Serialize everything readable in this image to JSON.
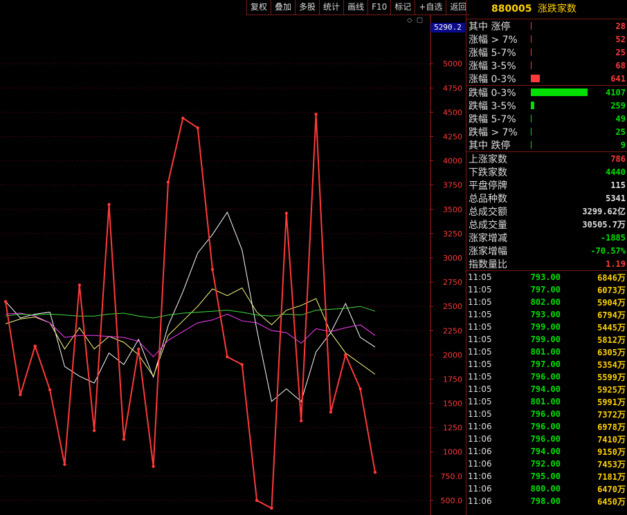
{
  "toolbar": [
    "复权",
    "叠加",
    "多股",
    "统计",
    "画线",
    "F10",
    "标记",
    "+自选",
    "返回"
  ],
  "current_price": "5290.2",
  "panel": {
    "code": "880005",
    "name": "涨跌家数",
    "rise": [
      {
        "label": "其中 涨停",
        "count": "28",
        "level": 0.007
      },
      {
        "label": "涨幅 > 7%",
        "count": "52",
        "level": 0.013
      },
      {
        "label": "涨幅 5-7%",
        "count": "25",
        "level": 0.006
      },
      {
        "label": "涨幅 3-5%",
        "count": "68",
        "level": 0.017
      },
      {
        "label": "涨幅 0-3%",
        "count": "641",
        "level": 0.156
      }
    ],
    "fall": [
      {
        "label": "跌幅 0-3%",
        "count": "4107",
        "level": 1.0
      },
      {
        "label": "跌幅 3-5%",
        "count": "259",
        "level": 0.063
      },
      {
        "label": "跌幅 5-7%",
        "count": "49",
        "level": 0.012
      },
      {
        "label": "跌幅 > 7%",
        "count": "25",
        "level": 0.006
      },
      {
        "label": "其中 跌停",
        "count": "9",
        "level": 0.002
      }
    ],
    "stats": [
      {
        "label": "上涨家数",
        "value": "786",
        "color": "red"
      },
      {
        "label": "下跌家数",
        "value": "4440",
        "color": "green"
      },
      {
        "label": "平盘停牌",
        "value": "115",
        "color": "white"
      },
      {
        "label": "总品种数",
        "value": "5341",
        "color": "white"
      },
      {
        "label": "总成交额",
        "value": "3299.62亿",
        "color": "white"
      },
      {
        "label": "总成交量",
        "value": "30505.7万",
        "color": "white"
      },
      {
        "label": "涨家增减",
        "value": "-1885",
        "color": "green"
      },
      {
        "label": "涨家增幅",
        "value": "-70.57%",
        "color": "green"
      },
      {
        "label": "指数量比",
        "value": "1.19",
        "color": "red"
      }
    ]
  },
  "ticks": [
    {
      "time": "11:05",
      "price": "793.00",
      "vol": "6846万"
    },
    {
      "time": "11:05",
      "price": "797.00",
      "vol": "6073万"
    },
    {
      "time": "11:05",
      "price": "802.00",
      "vol": "5904万"
    },
    {
      "time": "11:05",
      "price": "793.00",
      "vol": "6794万"
    },
    {
      "time": "11:05",
      "price": "799.00",
      "vol": "5445万"
    },
    {
      "time": "11:05",
      "price": "799.00",
      "vol": "5812万"
    },
    {
      "time": "11:05",
      "price": "801.00",
      "vol": "6305万"
    },
    {
      "time": "11:05",
      "price": "797.00",
      "vol": "5354万"
    },
    {
      "time": "11:05",
      "price": "796.00",
      "vol": "5599万"
    },
    {
      "time": "11:05",
      "price": "794.00",
      "vol": "5925万"
    },
    {
      "time": "11:05",
      "price": "801.00",
      "vol": "5991万"
    },
    {
      "time": "11:05",
      "price": "796.00",
      "vol": "7372万"
    },
    {
      "time": "11:06",
      "price": "796.00",
      "vol": "6978万"
    },
    {
      "time": "11:06",
      "price": "796.00",
      "vol": "7410万"
    },
    {
      "time": "11:06",
      "price": "794.00",
      "vol": "9150万"
    },
    {
      "time": "11:06",
      "price": "792.00",
      "vol": "7453万"
    },
    {
      "time": "11:06",
      "price": "795.00",
      "vol": "7181万"
    },
    {
      "time": "11:06",
      "price": "800.00",
      "vol": "6470万"
    },
    {
      "time": "11:06",
      "price": "798.00",
      "vol": "6450万"
    }
  ],
  "chart_data": {
    "type": "line",
    "ylim": [
      350,
      5500
    ],
    "yticks": [
      "5000",
      "4750",
      "4500",
      "4250",
      "4000",
      "3750",
      "3500",
      "3250",
      "3000",
      "2750",
      "2500",
      "2250",
      "2000",
      "1750",
      "1500",
      "1250",
      "1000",
      "750.0",
      "500.0"
    ],
    "grid": true,
    "colors": {
      "main": "#ff3a3a",
      "ma1": "#ffffff",
      "ma2": "#ffff80",
      "ma3": "#ff40ff",
      "ma4": "#40e040"
    },
    "series": [
      {
        "key": "main",
        "marker": true,
        "values": [
          2550,
          1590,
          2090,
          1640,
          870,
          2720,
          1220,
          3550,
          1130,
          2060,
          850,
          3780,
          4440,
          4340,
          2880,
          1980,
          1900,
          500,
          420,
          3460,
          1320,
          4480,
          1410,
          2000,
          1650,
          790
        ]
      },
      {
        "key": "ma1",
        "values": [
          2550,
          2380,
          2420,
          2440,
          1880,
          1780,
          1710,
          2020,
          1900,
          2160,
          1770,
          2300,
          2650,
          3050,
          3240,
          3470,
          3080,
          2260,
          1520,
          1650,
          1520,
          2030,
          2230,
          2530,
          2180,
          2080
        ]
      },
      {
        "key": "ma2",
        "values": [
          2320,
          2370,
          2390,
          2330,
          2060,
          2280,
          2060,
          2190,
          2130,
          2000,
          1780,
          2200,
          2350,
          2500,
          2680,
          2610,
          2690,
          2440,
          2310,
          2460,
          2510,
          2580,
          2230,
          2020,
          1910,
          1800
        ]
      },
      {
        "key": "ma3",
        "values": [
          2420,
          2430,
          2400,
          2330,
          2180,
          2200,
          2200,
          2190,
          2180,
          2140,
          1980,
          2150,
          2240,
          2330,
          2360,
          2420,
          2350,
          2330,
          2250,
          2230,
          2120,
          2270,
          2240,
          2280,
          2310,
          2200
        ]
      },
      {
        "key": "ma4",
        "values": [
          2400,
          2420,
          2410,
          2420,
          2410,
          2400,
          2400,
          2420,
          2430,
          2400,
          2380,
          2410,
          2430,
          2440,
          2450,
          2460,
          2440,
          2410,
          2400,
          2420,
          2410,
          2460,
          2470,
          2480,
          2500,
          2450
        ]
      }
    ]
  }
}
